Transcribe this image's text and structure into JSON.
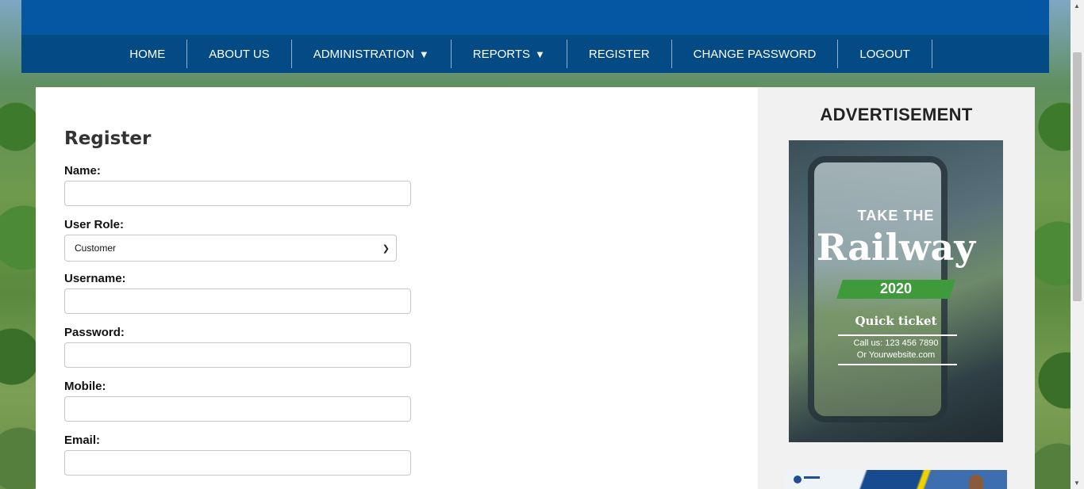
{
  "nav": {
    "items": [
      {
        "label": "HOME",
        "has_dropdown": false
      },
      {
        "label": "ABOUT US",
        "has_dropdown": false
      },
      {
        "label": "ADMINISTRATION",
        "has_dropdown": true
      },
      {
        "label": "REPORTS",
        "has_dropdown": true
      },
      {
        "label": "REGISTER",
        "has_dropdown": false
      },
      {
        "label": "CHANGE PASSWORD",
        "has_dropdown": false
      },
      {
        "label": "LOGOUT",
        "has_dropdown": false
      }
    ],
    "dropdown_glyph": "▼"
  },
  "form": {
    "title": "Register",
    "name_label": "Name:",
    "name_value": "",
    "role_label": "User Role:",
    "role_selected": "Customer",
    "username_label": "Username:",
    "username_value": "",
    "password_label": "Password:",
    "password_value": "",
    "mobile_label": "Mobile:",
    "mobile_value": "",
    "email_label": "Email:",
    "email_value": ""
  },
  "sidebar": {
    "title": "ADVERTISEMENT",
    "ad": {
      "line1": "TAKE THE",
      "line2": "Railway",
      "year": "2020",
      "tagline": "Quick ticket",
      "call": "Call us: 123 456 7890",
      "site": "Or Yourwebsite.com"
    }
  },
  "colors": {
    "topbar": "#0557a3",
    "navbar": "#044b85",
    "sidebar_bg": "#f1f1f1"
  }
}
